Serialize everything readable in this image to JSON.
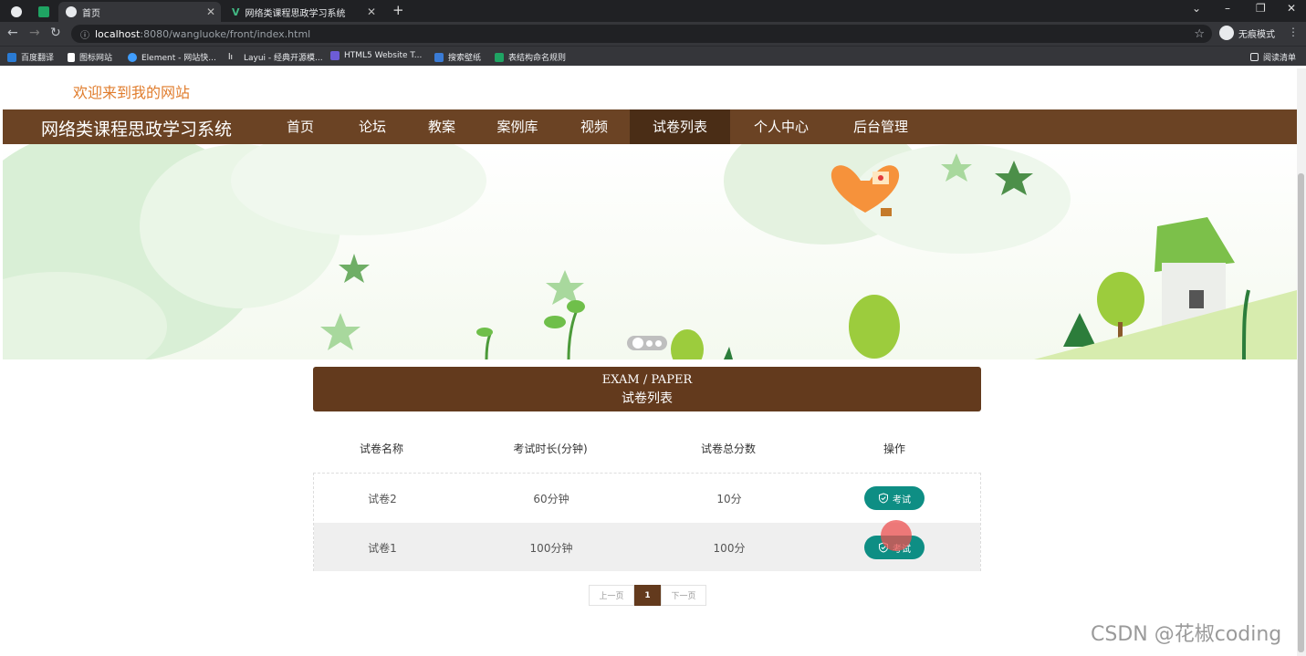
{
  "browser": {
    "tabs": [
      {
        "label": ""
      },
      {
        "label": ""
      },
      {
        "label": "首页"
      },
      {
        "label": "网络类课程思政学习系统"
      }
    ],
    "new_tab_symbol": "+",
    "window_controls": [
      "⌄",
      "–",
      "❐",
      "✕"
    ],
    "url_host": "localhost",
    "url_rest": ":8080/wangluoke/front/index.html",
    "incognito_label": "无痕模式",
    "bookmarks": [
      {
        "label": "百度翻译",
        "color": "#2a7bd4"
      },
      {
        "label": "图标网站",
        "color": "#ffffff"
      },
      {
        "label": "Element - 网站快...",
        "color": "#409eff"
      },
      {
        "label": "Layui - 经典开源模...",
        "color": "#ffffff"
      },
      {
        "label": "HTML5 Website T...",
        "color": "#6d5cd6"
      },
      {
        "label": "搜索壁纸",
        "color": "#3a7bd5"
      },
      {
        "label": "表结构命名规则",
        "color": "#1fa463"
      }
    ],
    "reading_list_label": "阅读清单"
  },
  "site": {
    "welcome": "欢迎来到我的网站",
    "brand": "网络类课程思政学习系统",
    "nav": [
      {
        "label": "首页"
      },
      {
        "label": "论坛"
      },
      {
        "label": "教案"
      },
      {
        "label": "案例库"
      },
      {
        "label": "视频"
      },
      {
        "label": "试卷列表",
        "active": true
      },
      {
        "label": "个人中心"
      },
      {
        "label": "后台管理"
      }
    ],
    "section_en": "EXAM / PAPER",
    "section_zh": "试卷列表",
    "table": {
      "headers": [
        "试卷名称",
        "考试时长(分钟)",
        "试卷总分数",
        "操作"
      ],
      "rows": [
        {
          "name": "试卷2",
          "duration": "60分钟",
          "score": "10分",
          "action": "考试"
        },
        {
          "name": "试卷1",
          "duration": "100分钟",
          "score": "100分",
          "action": "考试"
        }
      ]
    },
    "pagination": {
      "prev": "上一页",
      "current": "1",
      "next": "下一页"
    }
  },
  "watermark": "CSDN @花椒coding",
  "colors": {
    "nav_bg": "#6b4324",
    "nav_active": "#4a2d16",
    "section_head": "#633a1d",
    "exam_button": "#0e8e84",
    "welcome_text": "#e07c2c"
  }
}
